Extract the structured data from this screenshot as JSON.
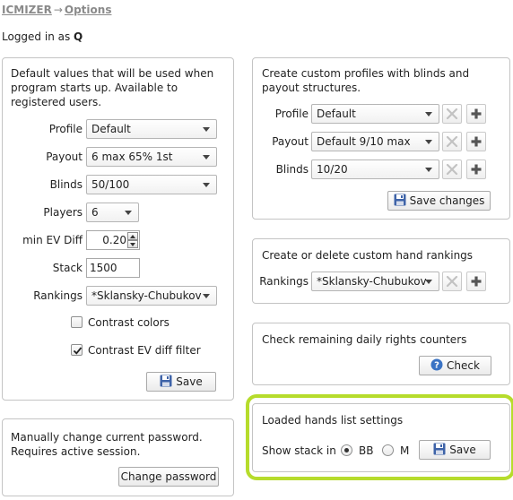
{
  "breadcrumb": {
    "home": "ICMIZER",
    "arrow": "→",
    "current": "Options"
  },
  "user": {
    "prefix": "Logged in as ",
    "name": "Q"
  },
  "defaults_panel": {
    "description": "Default values that will be used when program starts up. Available to registered users.",
    "profile": {
      "label": "Profile",
      "value": "Default"
    },
    "payout": {
      "label": "Payout",
      "value": "6 max 65% 1st"
    },
    "blinds": {
      "label": "Blinds",
      "value": "50/100"
    },
    "players": {
      "label": "Players",
      "value": "6"
    },
    "min_ev_diff": {
      "label": "min EV Diff",
      "value": "0.20"
    },
    "stack": {
      "label": "Stack",
      "value": "1500"
    },
    "rankings": {
      "label": "Rankings",
      "value": "*Sklansky-Chubukov"
    },
    "contrast_colors": {
      "label": "Contrast colors",
      "checked": false
    },
    "contrast_ev": {
      "label": "Contrast EV diff filter",
      "checked": true
    },
    "save_label": "Save"
  },
  "password_panel": {
    "description": "Manually change current password. Requires active session.",
    "button_label": "Change password"
  },
  "profiles_panel": {
    "description": "Create custom profiles with blinds and payout structures.",
    "profile": {
      "label": "Profile",
      "value": "Default"
    },
    "payout": {
      "label": "Payout",
      "value": "Default 9/10 max"
    },
    "blinds": {
      "label": "Blinds",
      "value": "10/20"
    },
    "save_label": "Save changes"
  },
  "rankings_panel": {
    "description": "Create or delete custom hand rankings",
    "label": "Rankings",
    "value": "*Sklansky-Chubukov"
  },
  "counters_panel": {
    "description": "Check remaining daily rights counters",
    "button_label": "Check"
  },
  "hands_panel": {
    "description": "Loaded hands list settings",
    "show_stack_label": "Show stack in",
    "option_bb": "BB",
    "option_m": "M",
    "selected": "BB",
    "save_label": "Save"
  },
  "colors": {
    "highlight": "#b6dc2c",
    "add_icon": "#555555",
    "check_icon": "#3a73c4"
  }
}
